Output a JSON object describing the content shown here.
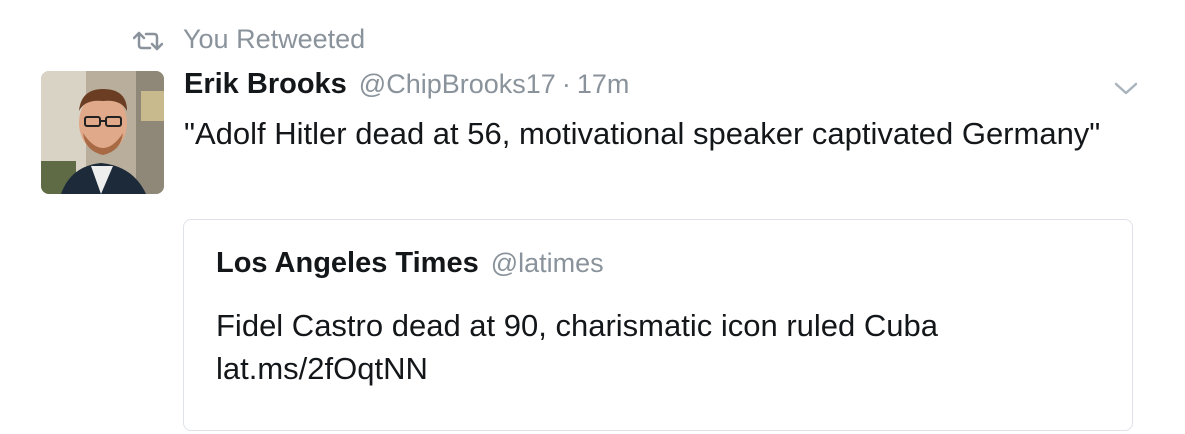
{
  "retweet_context": {
    "icon": "retweet-icon",
    "label": "You Retweeted"
  },
  "tweet": {
    "author_name": "Erik Brooks",
    "author_handle": "@ChipBrooks17",
    "separator": "·",
    "timestamp": "17m",
    "avatar": "avatar",
    "menu_icon": "chevron-down-icon",
    "text": "\"Adolf Hitler dead at 56, motivational speaker captivated Germany\""
  },
  "quoted_tweet": {
    "author_name": "Los Angeles Times",
    "author_handle": "@latimes",
    "text": "Fidel Castro dead at 90, charismatic icon ruled Cuba",
    "link": "lat.ms/2fOqtNN"
  },
  "colors": {
    "secondary_text": "#8a939b",
    "primary_text": "#14171a",
    "card_border": "#dfe3e7"
  }
}
